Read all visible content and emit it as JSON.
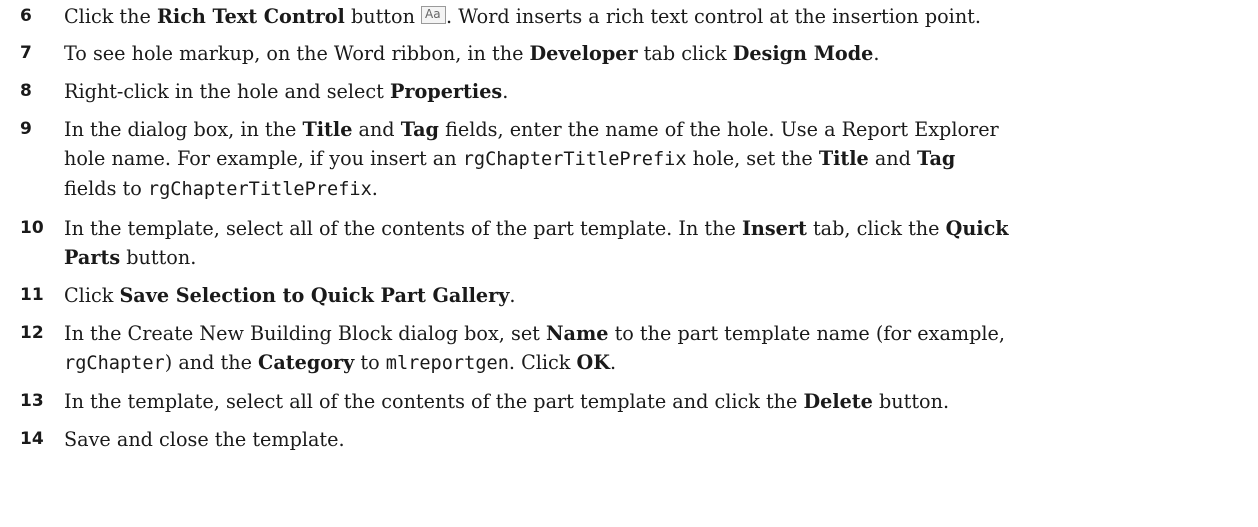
{
  "steps": [
    {
      "num": "6",
      "segments": [
        {
          "t": "Click the ",
          "s": "n"
        },
        {
          "t": "Rich Text Control",
          "s": "b"
        },
        {
          "t": " button ",
          "s": "n"
        },
        {
          "t": "Aa",
          "s": "icon",
          "icon": "rich-text-control-icon"
        },
        {
          "t": ". Word inserts a rich text control at the insertion point.",
          "s": "n"
        }
      ]
    },
    {
      "num": "7",
      "segments": [
        {
          "t": "To see hole markup, on the Word ribbon, in the ",
          "s": "n"
        },
        {
          "t": "Developer",
          "s": "b"
        },
        {
          "t": " tab click ",
          "s": "n"
        },
        {
          "t": "Design Mode",
          "s": "b"
        },
        {
          "t": ".",
          "s": "n"
        }
      ]
    },
    {
      "num": "8",
      "segments": [
        {
          "t": "Right-click in the hole and select ",
          "s": "n"
        },
        {
          "t": "Properties",
          "s": "b"
        },
        {
          "t": ".",
          "s": "n"
        }
      ]
    },
    {
      "num": "9",
      "segments": [
        {
          "t": "In the dialog box, in the ",
          "s": "n"
        },
        {
          "t": "Title",
          "s": "b"
        },
        {
          "t": " and ",
          "s": "n"
        },
        {
          "t": "Tag",
          "s": "b"
        },
        {
          "t": " fields, enter the name of the hole. Use a Report Explorer",
          "s": "n"
        },
        {
          "t": "",
          "s": "br"
        },
        {
          "t": "hole name. For example, if you insert an ",
          "s": "n"
        },
        {
          "t": "rgChapterTitlePrefix",
          "s": "c"
        },
        {
          "t": " hole, set the ",
          "s": "n"
        },
        {
          "t": "Title",
          "s": "b"
        },
        {
          "t": " and ",
          "s": "n"
        },
        {
          "t": "Tag",
          "s": "b"
        },
        {
          "t": "",
          "s": "br"
        },
        {
          "t": "fields to ",
          "s": "n"
        },
        {
          "t": "rgChapterTitlePrefix",
          "s": "c"
        },
        {
          "t": ".",
          "s": "n"
        }
      ]
    },
    {
      "num": "10",
      "segments": [
        {
          "t": "In the template, select all of the contents of the part template. In the ",
          "s": "n"
        },
        {
          "t": "Insert",
          "s": "b"
        },
        {
          "t": " tab, click the ",
          "s": "n"
        },
        {
          "t": "Quick",
          "s": "b"
        },
        {
          "t": "",
          "s": "br"
        },
        {
          "t": "Parts",
          "s": "b"
        },
        {
          "t": " button.",
          "s": "n"
        }
      ]
    },
    {
      "num": "11",
      "segments": [
        {
          "t": "Click ",
          "s": "n"
        },
        {
          "t": "Save Selection to Quick Part Gallery",
          "s": "b"
        },
        {
          "t": ".",
          "s": "n"
        }
      ]
    },
    {
      "num": "12",
      "segments": [
        {
          "t": "In the Create New Building Block dialog box, set ",
          "s": "n"
        },
        {
          "t": "Name",
          "s": "b"
        },
        {
          "t": " to the part template name (for example,",
          "s": "n"
        },
        {
          "t": "",
          "s": "br"
        },
        {
          "t": "rgChapter",
          "s": "c"
        },
        {
          "t": ") and the ",
          "s": "n"
        },
        {
          "t": "Category",
          "s": "b"
        },
        {
          "t": " to ",
          "s": "n"
        },
        {
          "t": "mlreportgen",
          "s": "c"
        },
        {
          "t": ". Click ",
          "s": "n"
        },
        {
          "t": "OK",
          "s": "b"
        },
        {
          "t": ".",
          "s": "n"
        }
      ]
    },
    {
      "num": "13",
      "segments": [
        {
          "t": "In the template, select all of the contents of the part template and click the ",
          "s": "n"
        },
        {
          "t": "Delete",
          "s": "b"
        },
        {
          "t": " button.",
          "s": "n"
        }
      ]
    },
    {
      "num": "14",
      "segments": [
        {
          "t": "Save and close the template.",
          "s": "n"
        }
      ]
    }
  ]
}
